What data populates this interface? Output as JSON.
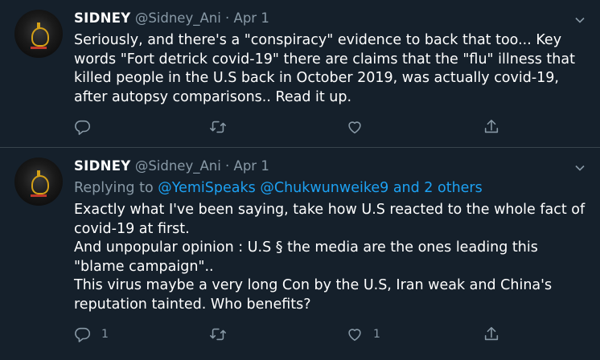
{
  "tweets": [
    {
      "display_name": "SIDNEY",
      "handle": "@Sidney_Ani",
      "dot": "·",
      "date": "Apr 1",
      "lines": [
        "Seriously, and there's a \"conspiracy\" evidence to back that too... Key",
        "words \"Fort detrick covid-19\" there are claims that the \"flu\" illness that",
        "killed people in the  U.S back in October 2019, was actually covid-19,",
        "after autopsy comparisons.. Read it up."
      ],
      "reply_count": "",
      "like_count": ""
    },
    {
      "display_name": "SIDNEY",
      "handle": "@Sidney_Ani",
      "dot": "·",
      "date": "Apr 1",
      "replying_to_label": "Replying to",
      "replying_to_link1": "@YemiSpeaks",
      "replying_to_link2": "@Chukwunweike9",
      "replying_to_others": "and 2 others",
      "lines": [
        "Exactly what I've been saying, take how U.S reacted to the whole fact of",
        "covid-19 at first.",
        "And unpopular opinion : U.S § the media are the ones leading this",
        "\"blame campaign\"..",
        "This virus maybe a very long Con by the U.S, Iran weak and China's",
        "reputation tainted. Who benefits?"
      ],
      "reply_count": "1",
      "like_count": "1"
    }
  ],
  "icons": [
    "reply-icon",
    "retweet-icon",
    "like-icon",
    "share-icon",
    "chevron-down-icon"
  ],
  "colors": {
    "background": "#15202b",
    "secondary_text": "#8899a6",
    "link": "#1da1f2",
    "divider": "#38444d"
  }
}
